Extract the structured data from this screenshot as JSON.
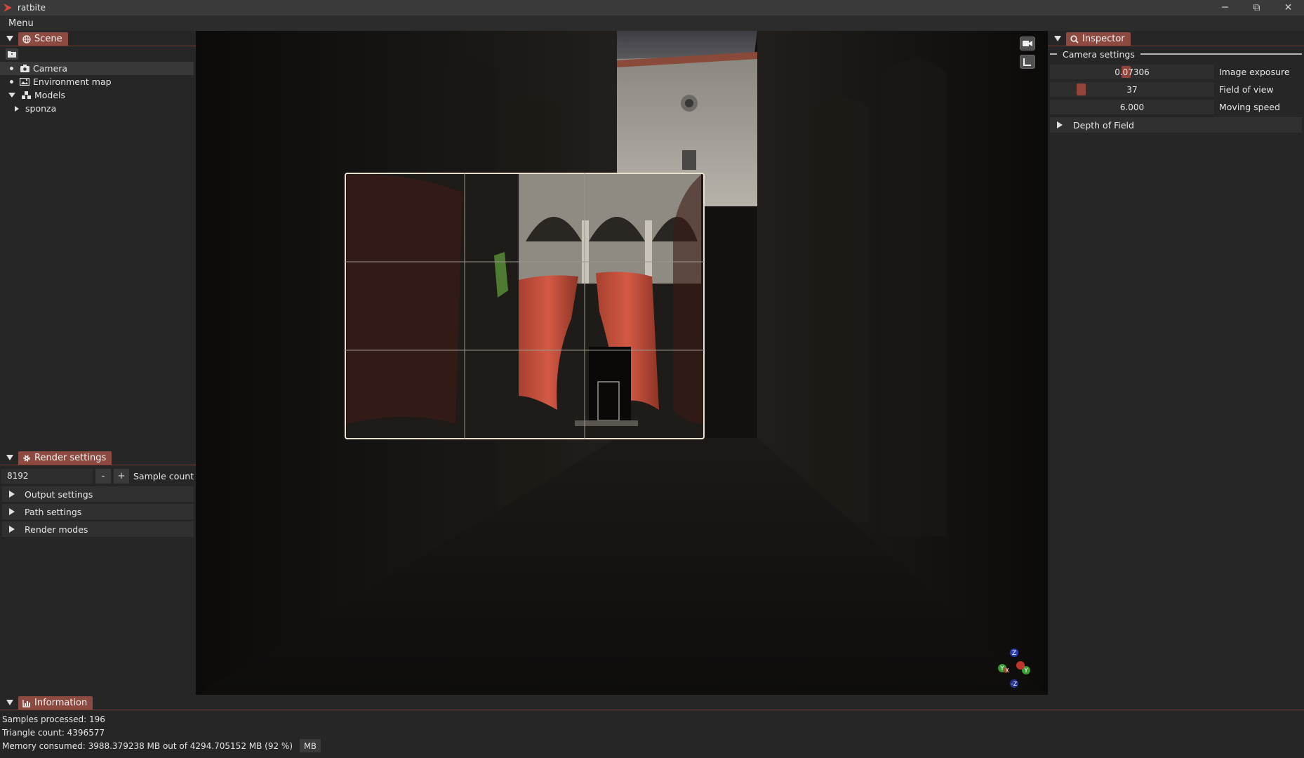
{
  "app": {
    "title": "ratbite"
  },
  "window_controls": {
    "minimize": "─",
    "restore": "⧉",
    "close": "✕"
  },
  "menubar": {
    "menu_label": "Menu"
  },
  "scene_panel": {
    "tab_label": "Scene",
    "tree": [
      {
        "label": "Camera",
        "icon": "camera-icon",
        "selected": true
      },
      {
        "label": "Environment map",
        "icon": "image-icon"
      },
      {
        "label": "Models",
        "icon": "models-icon",
        "expanded": true
      },
      {
        "label": "sponza",
        "collapsed": true
      }
    ]
  },
  "render_panel": {
    "tab_label": "Render settings",
    "sample_count_value": "8192",
    "minus": "-",
    "plus": "+",
    "sample_count_label": "Sample count",
    "sections": [
      "Output settings",
      "Path settings",
      "Render modes"
    ]
  },
  "inspector": {
    "tab_label": "Inspector",
    "section_title": "Camera settings",
    "properties": [
      {
        "value": "0.07306",
        "label": "Image exposure",
        "slider_fraction": 0.46
      },
      {
        "value": "37",
        "label": "Field of view",
        "slider_fraction": 0.17
      },
      {
        "value": "6.000",
        "label": "Moving speed"
      }
    ],
    "dof_label": "Depth of Field"
  },
  "viewport": {
    "gizmo": {
      "z_pos": "Z",
      "z_neg": "-Z",
      "y_pos": "Y",
      "y_neg": "Y",
      "x": "X"
    }
  },
  "information": {
    "tab_label": "Information",
    "samples_processed": "Samples processed: 196",
    "triangle_count": "Triangle count: 4396577",
    "memory_consumed": "Memory consumed: 3988.379238 MB out of 4294.705152 MB (92 %)",
    "unit_badge": "MB"
  },
  "colors": {
    "accent": "#8c4a40",
    "panel_bg": "#262626",
    "curtain": "#c8533e"
  }
}
